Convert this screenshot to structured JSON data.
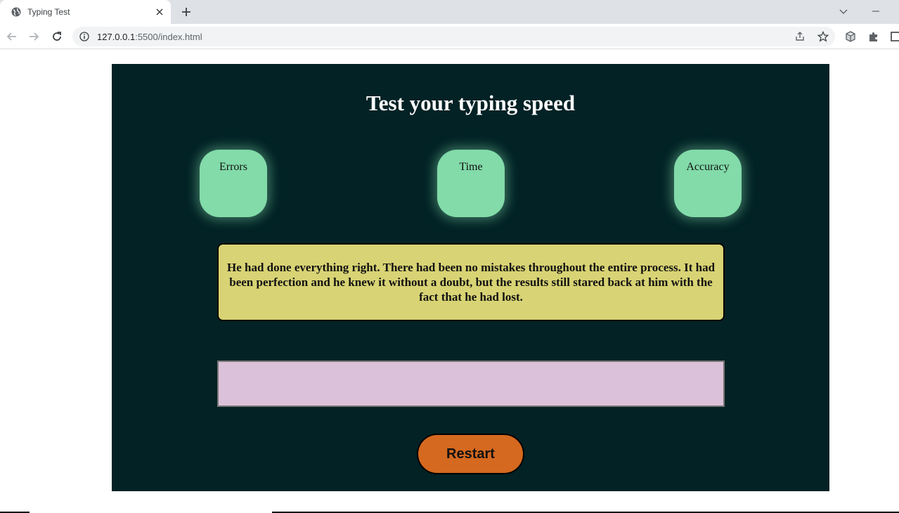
{
  "browser": {
    "tab_title": "Typing Test",
    "url_host": "127.0.0.1",
    "url_rest": ":5500/index.html"
  },
  "page": {
    "heading": "Test your typing speed",
    "stats": [
      {
        "label": "Errors",
        "value": ""
      },
      {
        "label": "Time",
        "value": ""
      },
      {
        "label": "Accuracy",
        "value": ""
      }
    ],
    "quote": "He had done everything right. There had been no mistakes throughout the entire process. It had been perfection and he knew it without a doubt, but the results still stared back at him with the fact that he had lost.",
    "input_value": "",
    "restart_label": "Restart"
  },
  "colors": {
    "background": "#022225",
    "stat_box": "#82dba9",
    "quote_box": "#d8d374",
    "input_box": "#dbc2da",
    "restart_button": "#d5691f"
  }
}
